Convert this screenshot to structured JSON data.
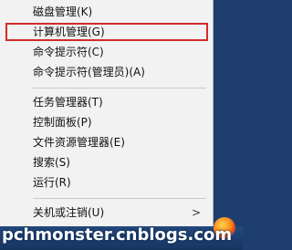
{
  "menu": {
    "items": [
      {
        "label": "磁盘管理(K)"
      },
      {
        "label": "计算机管理(G)"
      },
      {
        "label": "命令提示符(C)"
      },
      {
        "label": "命令提示符(管理员)(A)"
      },
      {
        "label": "任务管理器(T)"
      },
      {
        "label": "控制面板(P)"
      },
      {
        "label": "文件资源管理器(E)"
      },
      {
        "label": "搜索(S)"
      },
      {
        "label": "运行(R)"
      },
      {
        "label": "关机或注销(U)"
      }
    ],
    "submenu_glyph": ">"
  },
  "watermark": {
    "text": "pchmonster.cnblogs.com"
  },
  "taskbar": {
    "icon": "firefox-icon"
  },
  "colors": {
    "selection_border": "#d42b2b",
    "menu_bg": "#f2f2f2",
    "taskbar_bg": "#1d3e6e"
  }
}
